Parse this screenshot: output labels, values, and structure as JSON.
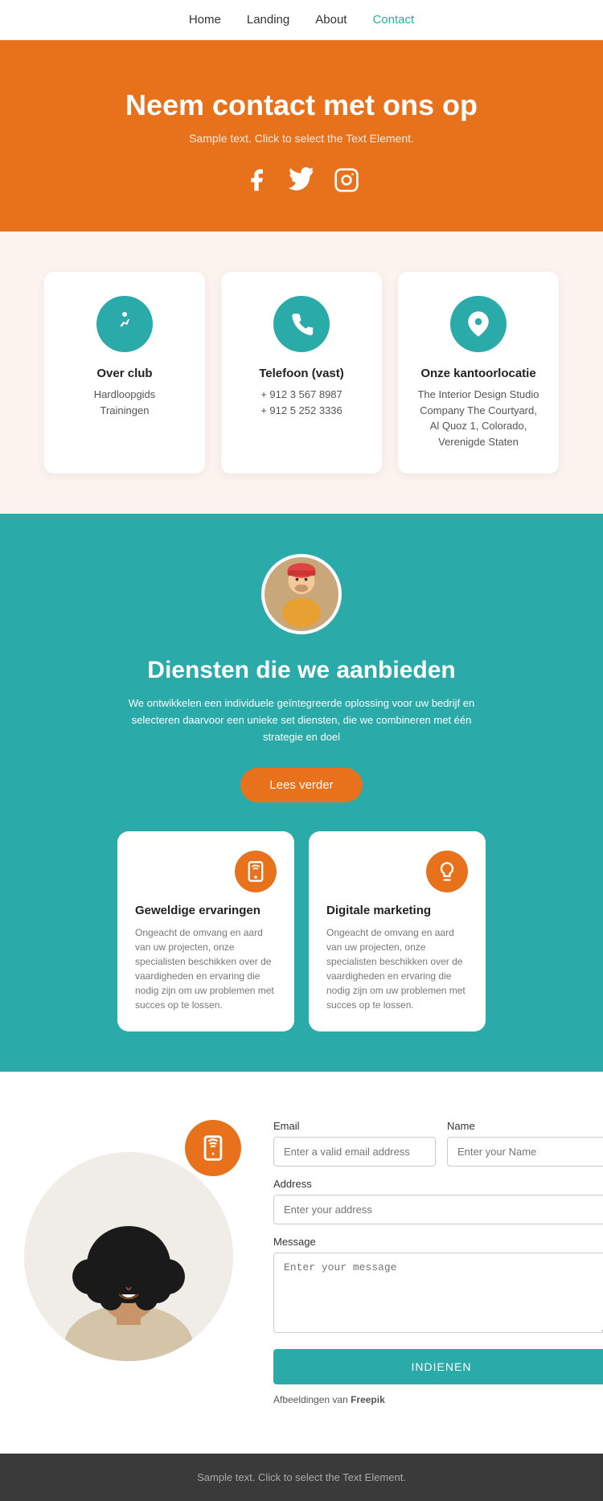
{
  "nav": {
    "items": [
      {
        "label": "Home",
        "active": false
      },
      {
        "label": "Landing",
        "active": false
      },
      {
        "label": "About",
        "active": false
      },
      {
        "label": "Contact",
        "active": true
      }
    ]
  },
  "hero": {
    "title": "Neem contact met ons op",
    "subtitle": "Sample text. Click to select the Text Element.",
    "social": [
      "facebook",
      "twitter",
      "instagram"
    ]
  },
  "cards": [
    {
      "icon": "run",
      "title": "Over club",
      "lines": [
        "Hardloopgids",
        "Trainingen"
      ]
    },
    {
      "icon": "phone",
      "title": "Telefoon (vast)",
      "lines": [
        "+ 912 3 567 8987",
        "+ 912 5 252 3336"
      ]
    },
    {
      "icon": "location",
      "title": "Onze kantoorlocatie",
      "lines": [
        "The Interior Design Studio Company The Courtyard, Al Quoz 1, Colorado, Verenigde Staten"
      ]
    }
  ],
  "services": {
    "title": "Diensten die we aanbieden",
    "description": "We ontwikkelen een individuele geïntegreerde oplossing voor uw bedrijf en selecteren daarvoor een unieke set diensten, die we combineren met één strategie en doel",
    "button_label": "Lees verder",
    "items": [
      {
        "icon": "mobile",
        "title": "Geweldige ervaringen",
        "description": "Ongeacht de omvang en aard van uw projecten, onze specialisten beschikken over de vaardigheden en ervaring die nodig zijn om uw problemen met succes op te lossen."
      },
      {
        "icon": "lightbulb",
        "title": "Digitale marketing",
        "description": "Ongeacht de omvang en aard van uw projecten, onze specialisten beschikken over de vaardigheden en ervaring die nodig zijn om uw problemen met succes op te lossen."
      }
    ]
  },
  "contact_form": {
    "email_label": "Email",
    "email_placeholder": "Enter a valid email address",
    "name_label": "Name",
    "name_placeholder": "Enter your Name",
    "address_label": "Address",
    "address_placeholder": "Enter your address",
    "message_label": "Message",
    "message_placeholder": "Enter your message",
    "submit_label": "INDIENEN",
    "freepik_text": "Afbeeldingen van ",
    "freepik_brand": "Freepik"
  },
  "footer": {
    "text": "Sample text. Click to select the Text Element."
  }
}
